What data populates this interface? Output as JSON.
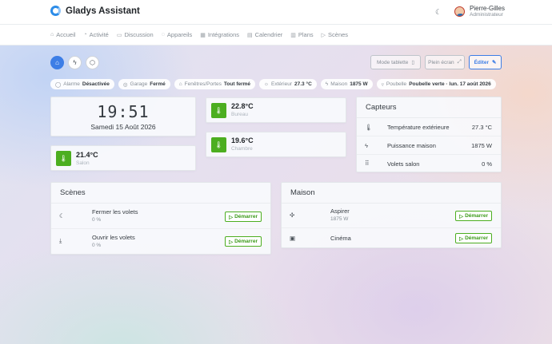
{
  "app": {
    "name": "Gladys Assistant"
  },
  "user": {
    "name": "Pierre-Gilles",
    "role": "Administrateur"
  },
  "nav": [
    {
      "label": "Accueil",
      "icon": "home-icon",
      "glyph": "⌂"
    },
    {
      "label": "Activité",
      "icon": "activity-icon",
      "glyph": "◔"
    },
    {
      "label": "Discussion",
      "icon": "chat-icon",
      "glyph": "▭"
    },
    {
      "label": "Appareils",
      "icon": "devices-icon",
      "glyph": "◌"
    },
    {
      "label": "Intégrations",
      "icon": "grid-icon",
      "glyph": "▦"
    },
    {
      "label": "Calendrier",
      "icon": "calendar-icon",
      "glyph": "▤"
    },
    {
      "label": "Plans",
      "icon": "map-icon",
      "glyph": "▥"
    },
    {
      "label": "Scènes",
      "icon": "play-icon",
      "glyph": "▷"
    }
  ],
  "toolbar": {
    "tablet_mode": "Mode tablette",
    "fullscreen": "Plein écran",
    "edit": "Éditer"
  },
  "status": {
    "alarm_label": "Alarme",
    "alarm_value": "Désactivée",
    "garage_label": "Garage",
    "garage_value": "Fermé",
    "windows_label": "Fenêtres/Portes",
    "windows_value": "Tout fermé",
    "outdoor_label": "Extérieur",
    "outdoor_value": "27.3 °C",
    "house_label": "Maison",
    "house_value": "1875 W",
    "trash_label": "Poubelle",
    "trash_value": "Poubelle verte · lun. 17 août 2026"
  },
  "clock": {
    "time": "19:51",
    "date": "Samedi 15 Août 2026"
  },
  "temperatures": [
    {
      "value": "22.8°C",
      "room": "Bureau"
    },
    {
      "value": "19.6°C",
      "room": "Chambre"
    },
    {
      "value": "21.4°C",
      "room": "Salon"
    }
  ],
  "sensors": {
    "title": "Capteurs",
    "rows": [
      {
        "label": "Température extérieure",
        "value": "27.3 °C",
        "glyph": "🌡"
      },
      {
        "label": "Puissance maison",
        "value": "1875 W",
        "glyph": "ϟ"
      },
      {
        "label": "Volets salon",
        "value": "0 %",
        "glyph": "⠿"
      }
    ]
  },
  "scenes": {
    "title": "Scènes",
    "start_label": "Démarrer",
    "rows": [
      {
        "label": "Fermer les volets",
        "sub": "0 %",
        "glyph": "☾"
      },
      {
        "label": "Ouvrir les volets",
        "sub": "0 %",
        "glyph": "⤓"
      }
    ]
  },
  "house": {
    "title": "Maison",
    "start_label": "Démarrer",
    "rows": [
      {
        "label": "Aspirer",
        "sub": "1875 W",
        "glyph": "✣"
      },
      {
        "label": "Cinéma",
        "sub": "",
        "glyph": "▣"
      }
    ]
  },
  "colors": {
    "accent": "#3d7ee6",
    "success": "#4cae20"
  }
}
